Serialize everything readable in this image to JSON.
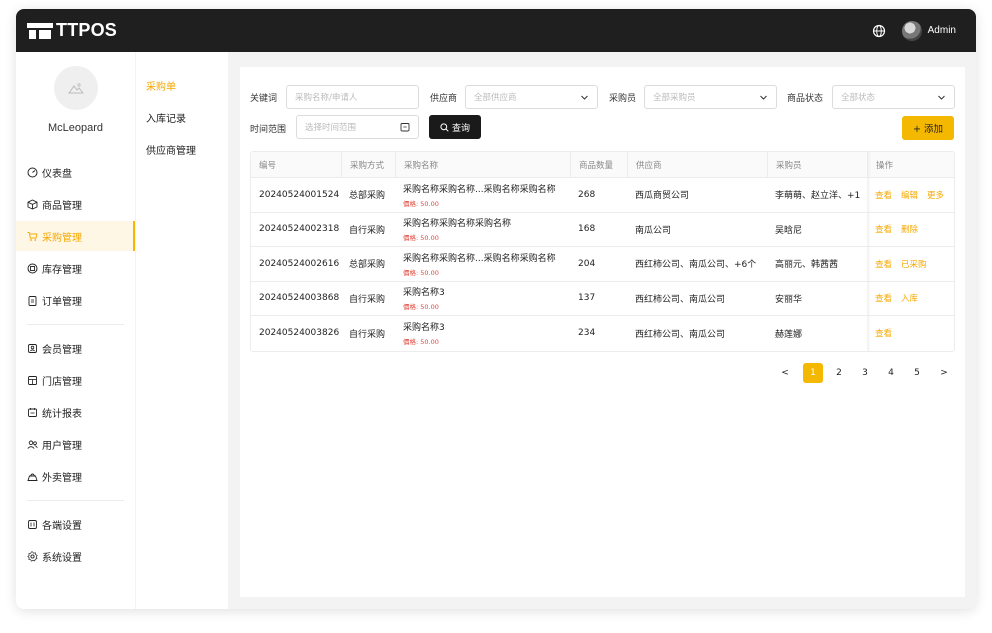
{
  "app": {
    "title": "TTPOS"
  },
  "header": {
    "globe_icon": "globe-icon",
    "user_label": "Admin"
  },
  "user": {
    "name": "McLeopard"
  },
  "sidebar": {
    "items": [
      {
        "label": "仪表盘",
        "icon": "dashboard-icon"
      },
      {
        "label": "商品管理",
        "icon": "box-icon"
      },
      {
        "label": "采购管理",
        "icon": "cart-icon",
        "active": true
      },
      {
        "label": "库存管理",
        "icon": "inventory-icon"
      },
      {
        "label": "订单管理",
        "icon": "clipboard-icon"
      },
      {
        "label": "会员管理",
        "icon": "member-icon"
      },
      {
        "label": "门店管理",
        "icon": "store-icon"
      },
      {
        "label": "统计报表",
        "icon": "report-icon"
      },
      {
        "label": "用户管理",
        "icon": "users-icon"
      },
      {
        "label": "外卖管理",
        "icon": "delivery-icon"
      },
      {
        "label": "各端设置",
        "icon": "devices-icon"
      },
      {
        "label": "系统设置",
        "icon": "settings-icon"
      }
    ]
  },
  "subnav": {
    "items": [
      {
        "label": "采购单",
        "active": true
      },
      {
        "label": "入库记录"
      },
      {
        "label": "供应商管理"
      }
    ]
  },
  "filters": {
    "keyword_label": "关键词",
    "keyword_placeholder": "采购名称/申请人",
    "supplier_label": "供应商",
    "supplier_value": "全部供应商",
    "buyer_label": "采购员",
    "buyer_value": "全部采购员",
    "status_label": "商品状态",
    "status_value": "全部状态",
    "time_label": "时间范围",
    "time_placeholder": "选择时间范围",
    "search_label": "查询",
    "add_label": "+ 添加"
  },
  "table": {
    "columns": [
      "编号",
      "采购方式",
      "采购名称",
      "商品数量",
      "供应商",
      "采购员",
      "操作"
    ],
    "price_prefix": "價格: ",
    "rows": [
      {
        "id": "20240524001524",
        "mode": "总部采购",
        "name": "采购名称采购名称...采购名称采购名称",
        "price": "50.00",
        "qty": "268",
        "supplier": "西瓜商贸公司",
        "buyer": "李萌萌、赵立洋、+1",
        "ops": [
          "查看",
          "编辑",
          "更多"
        ]
      },
      {
        "id": "20240524002318",
        "mode": "自行采购",
        "name": "采购名称采购名称采购名称",
        "price": "50.00",
        "qty": "168",
        "supplier": "南瓜公司",
        "buyer": "吴晗尼",
        "ops": [
          "查看",
          "删除"
        ]
      },
      {
        "id": "20240524002616",
        "mode": "总部采购",
        "name": "采购名称采购名称...采购名称采购名称",
        "price": "50.00",
        "qty": "204",
        "supplier": "西红柿公司、南瓜公司、+6个",
        "buyer": "高丽元、韩茜茜",
        "ops": [
          "查看",
          "已采购"
        ]
      },
      {
        "id": "20240524003868",
        "mode": "自行采购",
        "name": "采购名称3",
        "price": "50.00",
        "qty": "137",
        "supplier": "西红柿公司、南瓜公司",
        "buyer": "安丽华",
        "ops": [
          "查看",
          "入库"
        ]
      },
      {
        "id": "20240524003826",
        "mode": "自行采购",
        "name": "采购名称3",
        "price": "50.00",
        "qty": "234",
        "supplier": "西红柿公司、南瓜公司",
        "buyer": "赫莲娜",
        "ops": [
          "查看"
        ]
      }
    ]
  },
  "pagination": {
    "prev": "<",
    "next": ">",
    "pages": [
      "1",
      "2",
      "3",
      "4",
      "5"
    ],
    "current": "1"
  },
  "colors": {
    "accent": "#f5b800",
    "topbar": "#1f1f1f",
    "price": "#e0483d"
  }
}
